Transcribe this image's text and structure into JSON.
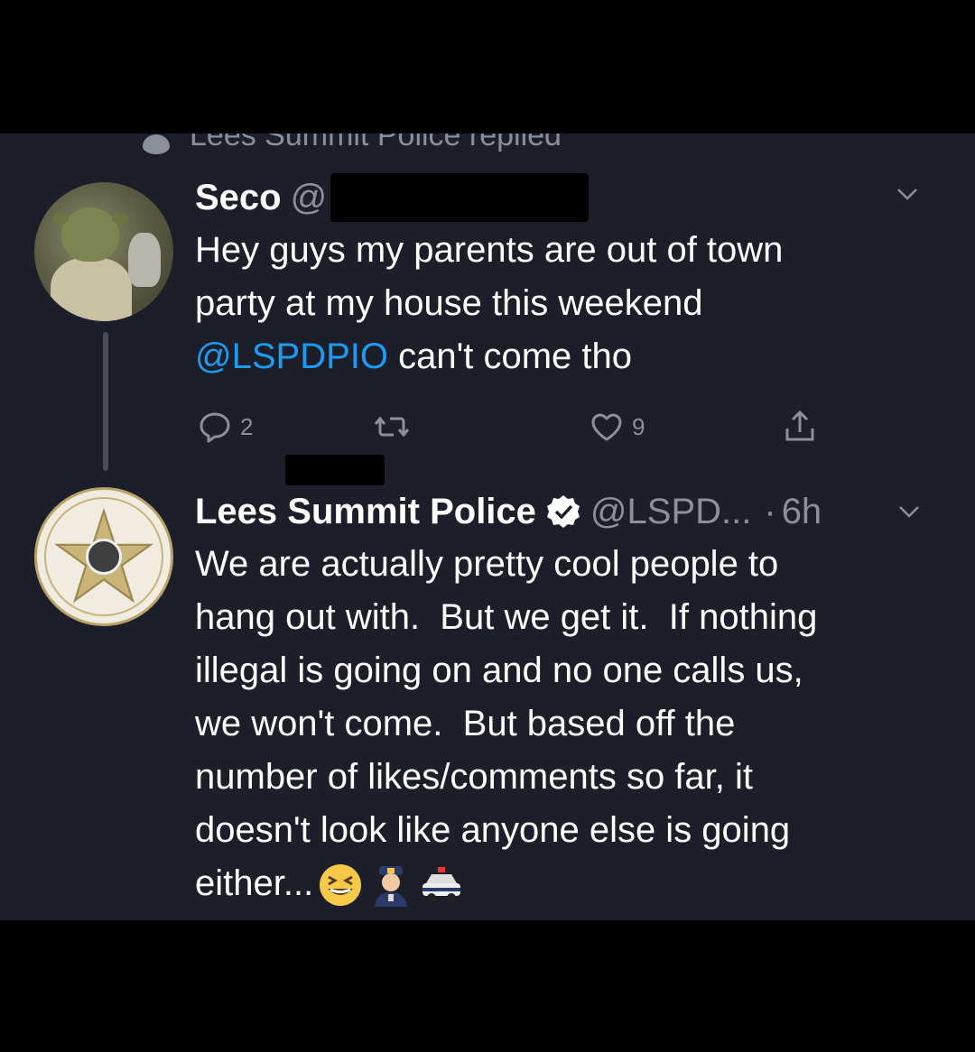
{
  "replied_header": "Lees Summit Police replied",
  "tweet1": {
    "name": "Seco",
    "handle": "@",
    "text_line1": "Hey guys my parents are out of town",
    "text_line2": "party at my house this weekend",
    "mention": "@LSPDPIO",
    "text_line3_rest": " can't come tho",
    "reply_count": "2",
    "like_count": "9"
  },
  "tweet2": {
    "name": "Lees Summit Police",
    "handle": "@LSPD...",
    "dot": "·",
    "time": "6h",
    "text": "We are actually pretty cool people to\nhang out with.  But we get it.  If nothing\nillegal is going on and no one calls us,\nwe won't come.  But based off the\nnumber of likes/comments so far, it\ndoesn't look like anyone else is going\neither...",
    "emojis": [
      "grinning-squinting-face",
      "police-officer",
      "police-car"
    ]
  },
  "colors": {
    "background": "#1c1e2a",
    "text": "#ffffff",
    "secondary": "#8b8f9a",
    "link": "#1d9bf0",
    "verified": "#ffffff"
  }
}
